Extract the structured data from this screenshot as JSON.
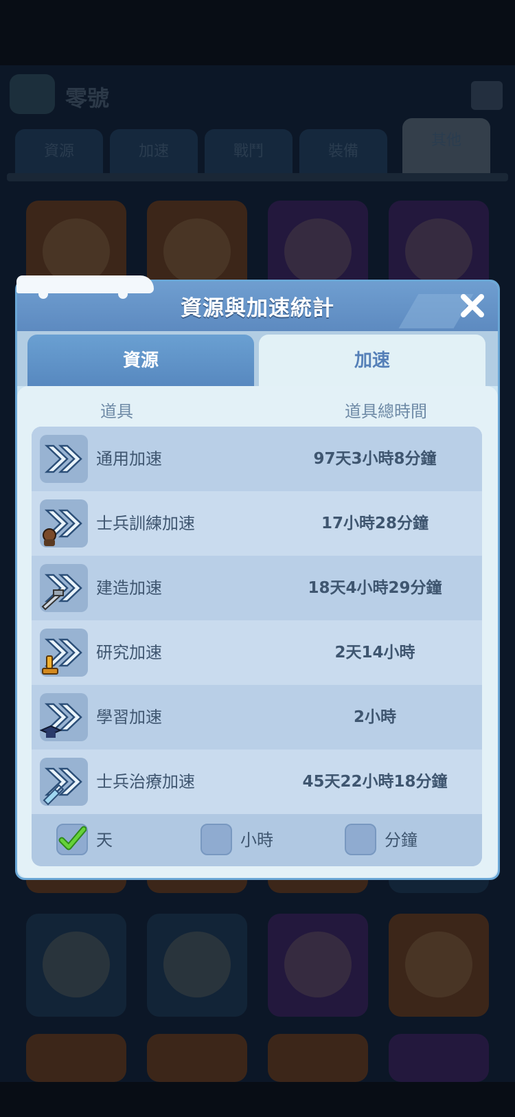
{
  "background": {
    "header_title": "零號",
    "tabs": [
      "資源",
      "加速",
      "戰鬥",
      "裝備",
      "其他"
    ]
  },
  "modal": {
    "title": "資源與加速統計",
    "tabs": {
      "resources": "資源",
      "speedup": "加速"
    },
    "columns": {
      "item": "道具",
      "total_time": "道具總時間"
    },
    "rows": [
      {
        "name": "通用加速",
        "time": "97天3小時8分鐘",
        "icon": "speedup-general-icon",
        "badge": ""
      },
      {
        "name": "士兵訓練加速",
        "time": "17小時28分鐘",
        "icon": "speedup-training-icon",
        "badge": "soldier"
      },
      {
        "name": "建造加速",
        "time": "18天4小時29分鐘",
        "icon": "speedup-building-icon",
        "badge": "hammer"
      },
      {
        "name": "研究加速",
        "time": "2天14小時",
        "icon": "speedup-research-icon",
        "badge": "microscope"
      },
      {
        "name": "學習加速",
        "time": "2小時",
        "icon": "speedup-learning-icon",
        "badge": "graduation-cap"
      },
      {
        "name": "士兵治療加速",
        "time": "45天22小時18分鐘",
        "icon": "speedup-healing-icon",
        "badge": "syringe"
      }
    ],
    "filters": [
      {
        "label": "天",
        "checked": true
      },
      {
        "label": "小時",
        "checked": false
      },
      {
        "label": "分鐘",
        "checked": false
      }
    ]
  },
  "colors": {
    "accent": "#5d8ac0",
    "check_green": "#3fae2a",
    "text": "#3f5670"
  }
}
